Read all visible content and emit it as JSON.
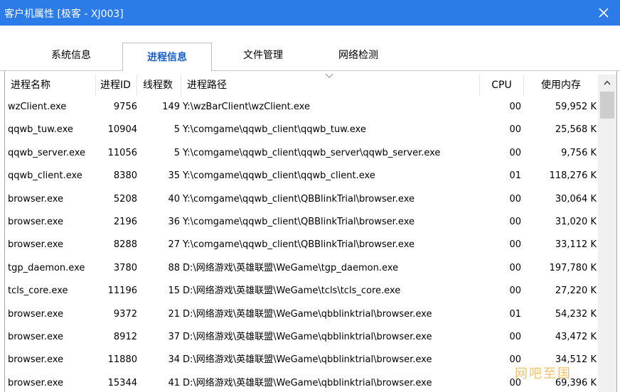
{
  "window": {
    "title": "客户机属性 [极客 - XJ003]"
  },
  "tabs": [
    {
      "label": "系统信息",
      "active": false
    },
    {
      "label": "进程信息",
      "active": true
    },
    {
      "label": "文件管理",
      "active": false
    },
    {
      "label": "网络检测",
      "active": false
    }
  ],
  "table": {
    "columns": {
      "name": "进程名称",
      "pid": "进程ID",
      "threads": "线程数",
      "path": "进程路径",
      "cpu": "CPU",
      "memory": "使用内存"
    },
    "rows": [
      {
        "name": "wzClient.exe",
        "pid": "9756",
        "threads": "149",
        "path": "Y:\\wzBarClient\\wzClient.exe",
        "cpu": "00",
        "memory": "59,952 K"
      },
      {
        "name": "qqwb_tuw.exe",
        "pid": "10904",
        "threads": "5",
        "path": "Y:\\comgame\\qqwb_client\\qqwb_tuw.exe",
        "cpu": "00",
        "memory": "25,568 K"
      },
      {
        "name": "qqwb_server.exe",
        "pid": "11056",
        "threads": "5",
        "path": "Y:\\comgame\\qqwb_client\\qqwb_server\\qqwb_server.exe",
        "cpu": "00",
        "memory": "9,756 K"
      },
      {
        "name": "qqwb_client.exe",
        "pid": "8380",
        "threads": "35",
        "path": "Y:\\comgame\\qqwb_client\\qqwb_client.exe",
        "cpu": "01",
        "memory": "118,276 K"
      },
      {
        "name": "browser.exe",
        "pid": "5208",
        "threads": "40",
        "path": "Y:\\comgame\\qqwb_client\\QBBlinkTrial\\browser.exe",
        "cpu": "00",
        "memory": "30,064 K"
      },
      {
        "name": "browser.exe",
        "pid": "2196",
        "threads": "36",
        "path": "Y:\\comgame\\qqwb_client\\QBBlinkTrial\\browser.exe",
        "cpu": "00",
        "memory": "31,020 K"
      },
      {
        "name": "browser.exe",
        "pid": "8288",
        "threads": "27",
        "path": "Y:\\comgame\\qqwb_client\\QBBlinkTrial\\browser.exe",
        "cpu": "00",
        "memory": "33,112 K"
      },
      {
        "name": "tgp_daemon.exe",
        "pid": "3780",
        "threads": "88",
        "path": "D:\\网络游戏\\英雄联盟\\WeGame\\tgp_daemon.exe",
        "cpu": "00",
        "memory": "197,780 K"
      },
      {
        "name": "tcls_core.exe",
        "pid": "11196",
        "threads": "15",
        "path": "D:\\网络游戏\\英雄联盟\\WeGame\\tcls\\tcls_core.exe",
        "cpu": "00",
        "memory": "27,220 K"
      },
      {
        "name": "browser.exe",
        "pid": "9372",
        "threads": "21",
        "path": "D:\\网络游戏\\英雄联盟\\WeGame\\qbblinktrial\\browser.exe",
        "cpu": "01",
        "memory": "54,232 K"
      },
      {
        "name": "browser.exe",
        "pid": "8912",
        "threads": "37",
        "path": "D:\\网络游戏\\英雄联盟\\WeGame\\qbblinktrial\\browser.exe",
        "cpu": "00",
        "memory": "43,472 K"
      },
      {
        "name": "browser.exe",
        "pid": "11880",
        "threads": "34",
        "path": "D:\\网络游戏\\英雄联盟\\WeGame\\qbblinktrial\\browser.exe",
        "cpu": "00",
        "memory": "34,512 K"
      },
      {
        "name": "browser.exe",
        "pid": "15344",
        "threads": "41",
        "path": "D:\\网络游戏\\英雄联盟\\WeGame\\qbblinktrial\\browser.exe",
        "cpu": "00",
        "memory": "69,396 K"
      }
    ]
  },
  "watermark": {
    "text": "网吧至国"
  },
  "icons": {
    "close": "close-icon",
    "scroll_up": "chevron-up-icon",
    "sort": "sort-caret-icon"
  },
  "colors": {
    "titlebar": "#2b7be9",
    "active_tab_text": "#1a5fcc"
  }
}
